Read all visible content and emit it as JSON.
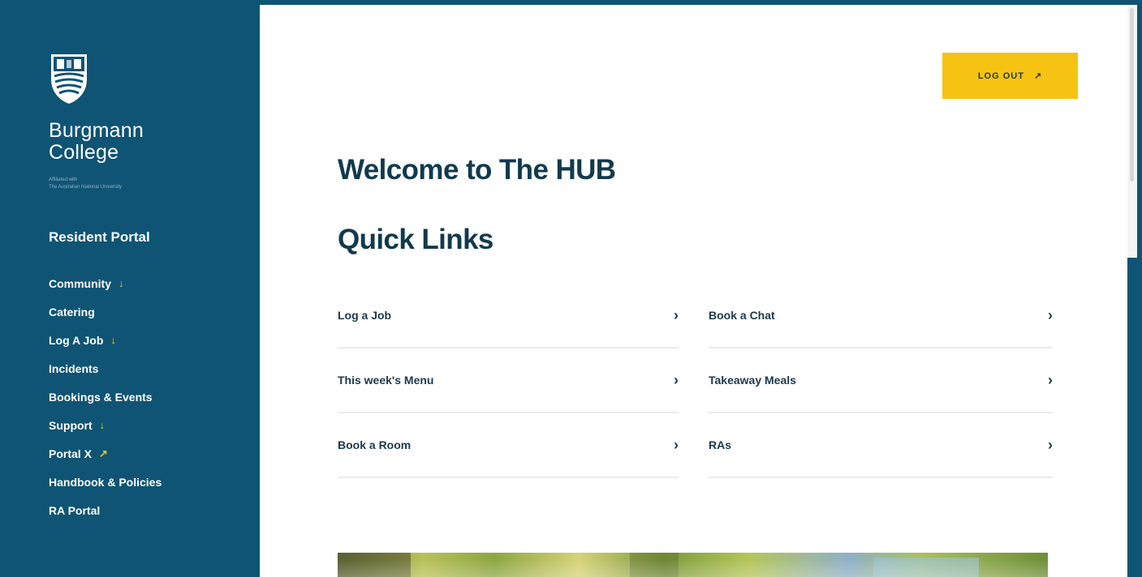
{
  "brand": {
    "name_line1": "Burgmann",
    "name_line2": "College",
    "affiliation_line1": "Affiliated with",
    "affiliation_line2": "The Australian National University"
  },
  "sidebar": {
    "title": "Resident Portal",
    "items": [
      {
        "label": "Community",
        "arrow": "↓"
      },
      {
        "label": "Catering",
        "arrow": ""
      },
      {
        "label": "Log A Job",
        "arrow": "↓"
      },
      {
        "label": "Incidents",
        "arrow": ""
      },
      {
        "label": "Bookings & Events",
        "arrow": ""
      },
      {
        "label": "Support",
        "arrow": "↓"
      },
      {
        "label": "Portal X",
        "arrow": "↗"
      },
      {
        "label": "Handbook & Policies",
        "arrow": ""
      },
      {
        "label": "RA Portal",
        "arrow": ""
      }
    ]
  },
  "header": {
    "logout_label": "LOG OUT",
    "logout_icon": "↗"
  },
  "main": {
    "welcome": "Welcome to The HUB",
    "quick_links_title": "Quick Links",
    "quick_links": [
      {
        "label": "Log a Job"
      },
      {
        "label": "Book a Chat"
      },
      {
        "label": "This week's Menu"
      },
      {
        "label": "Takeaway Meals"
      },
      {
        "label": "Book a Room"
      },
      {
        "label": "RAs"
      }
    ],
    "chevron": "›"
  },
  "colors": {
    "sidebar_bg": "#0f5474",
    "accent": "#f6c313",
    "heading": "#113a4d"
  }
}
